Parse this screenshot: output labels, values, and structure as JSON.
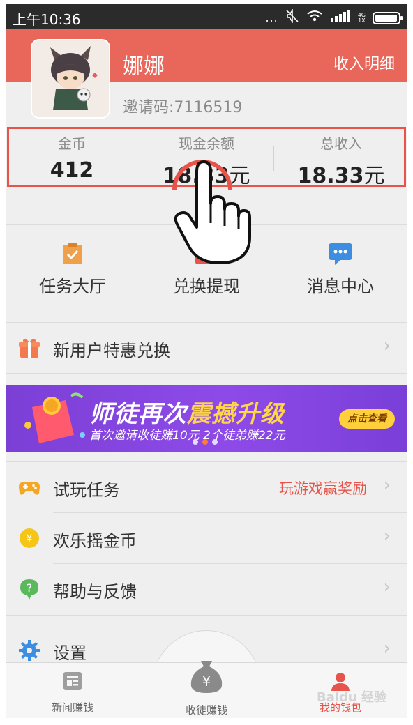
{
  "status_bar": {
    "time": "上午10:36",
    "dots": "...",
    "net_top": "4G",
    "net_bottom": "1X"
  },
  "header": {
    "username": "娜娜",
    "income_link": "收入明细",
    "invite_code": "邀请码:7116519"
  },
  "stats": [
    {
      "label": "金币",
      "value": "412",
      "unit": ""
    },
    {
      "label": "现金余额",
      "value": "18.33",
      "unit": "元"
    },
    {
      "label": "总收入",
      "value": "18.33",
      "unit": "元"
    }
  ],
  "quick_actions": [
    {
      "label": "任务大厅",
      "icon": "clipboard-check-icon"
    },
    {
      "label": "兑换提现",
      "icon": "wallet-icon"
    },
    {
      "label": "消息中心",
      "icon": "chat-bubble-icon"
    }
  ],
  "list_top": {
    "new_user": {
      "label": "新用户特惠兑换",
      "icon": "gift-icon"
    }
  },
  "banner": {
    "title_part1": "师徒再次",
    "title_part2": "震撼升级",
    "subtitle": "首次邀请收徒赚10元 2个徒弟赚22元",
    "button": "点击查看"
  },
  "list_bottom": {
    "trial": {
      "label": "试玩任务",
      "right": "玩游戏赢奖励",
      "icon": "gamepad-icon"
    },
    "shake": {
      "label": "欢乐摇金币",
      "icon": "coin-icon"
    },
    "help": {
      "label": "帮助与反馈",
      "icon": "question-icon"
    },
    "settings": {
      "label": "设置",
      "icon": "gear-icon"
    }
  },
  "bottom_nav": [
    {
      "label": "新闻赚钱",
      "icon": "news-icon"
    },
    {
      "label": "收徒赚钱",
      "icon": "money-bag-icon"
    },
    {
      "label": "我的钱包",
      "icon": "user-icon"
    }
  ],
  "watermark": "Baidu 经验",
  "colors": {
    "brand": "#e8675a",
    "accent_red": "#e8544a",
    "banner_purple": "#8e4ae8",
    "banner_yellow": "#ffd54a"
  }
}
